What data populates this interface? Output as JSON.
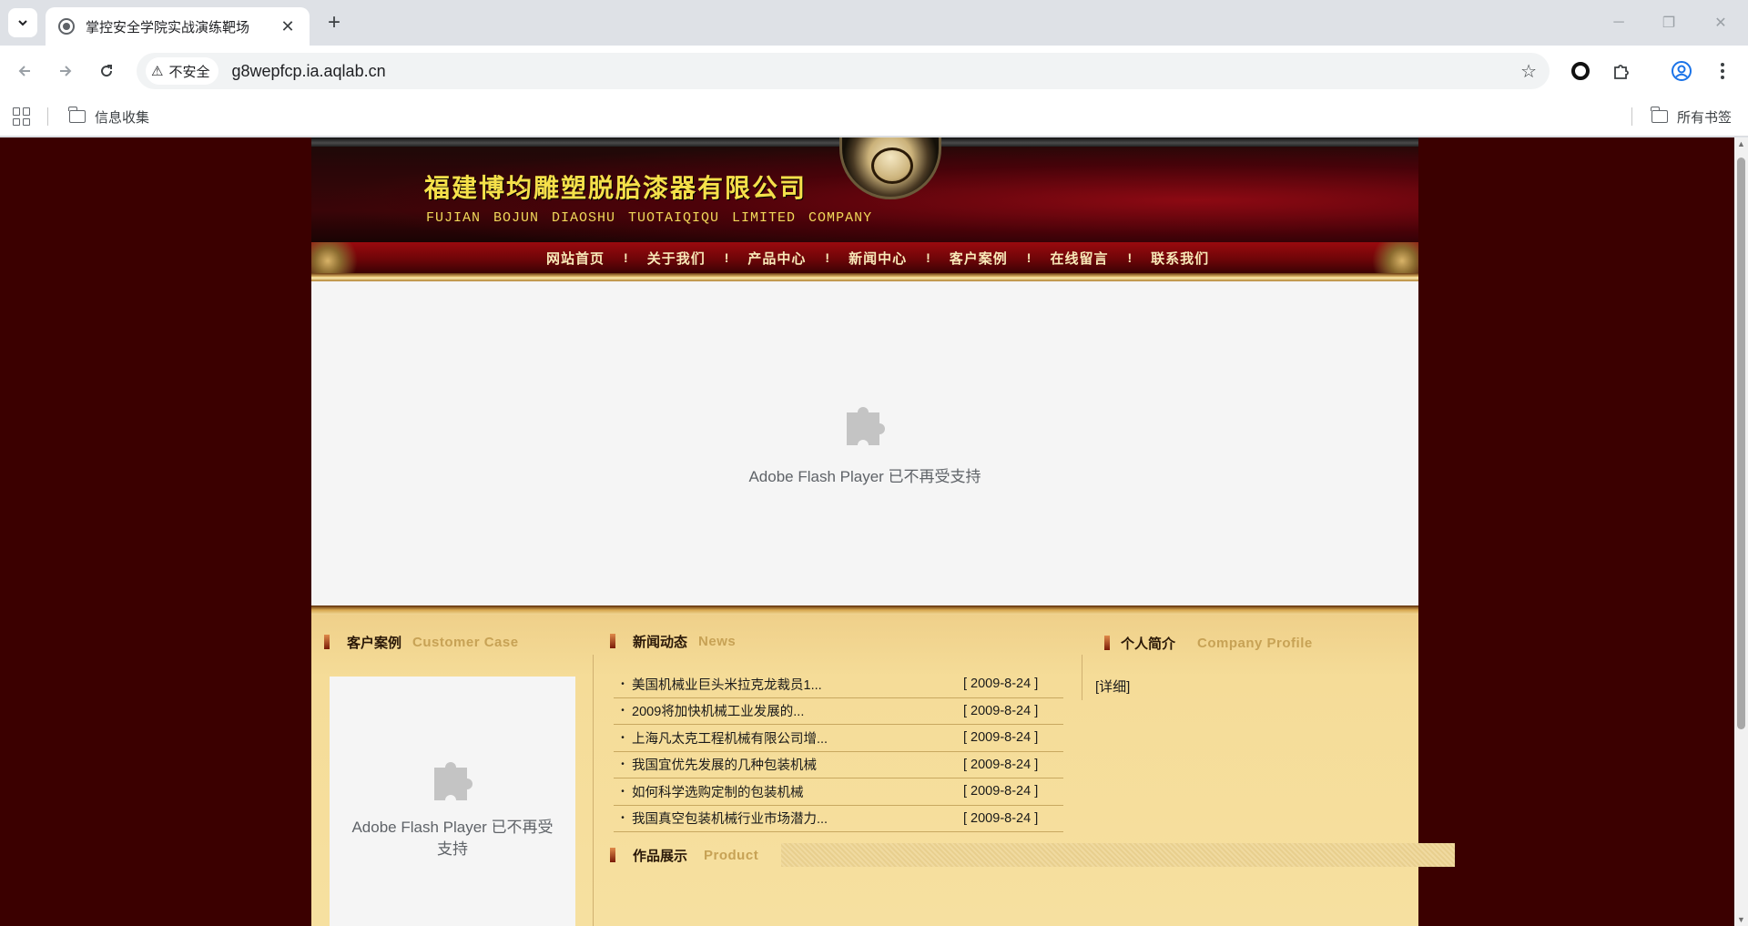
{
  "browser": {
    "tab_title": "掌控安全学院实战演练靶场",
    "security_label": "不安全",
    "url": "g8wepfcp.ia.aqlab.cn",
    "bookmarks": [
      {
        "label": "信息收集"
      }
    ],
    "all_bookmarks_label": "所有书签"
  },
  "site": {
    "company_cn": "福建博均雕塑脱胎漆器有限公司",
    "company_en": "FUJIAN BOJUN DIAOSHU  TUOTAIQIQU  LIMITED COMPANY",
    "nav": [
      "网站首页",
      "关于我们",
      "产品中心",
      "新闻中心",
      "客户案例",
      "在线留言",
      "联系我们"
    ],
    "nav_separator": "!",
    "flash_message": "Adobe Flash Player 已不再受支持",
    "sections": {
      "customer_case": {
        "cn": "客户案例",
        "en": "Customer Case"
      },
      "news": {
        "cn": "新闻动态",
        "en": "News"
      },
      "profile": {
        "cn": "个人简介",
        "en": "Company Profile"
      },
      "product": {
        "cn": "作品展示",
        "en": "Product"
      }
    },
    "news_items": [
      {
        "title": "美国机械业巨头米拉克龙裁员1...",
        "date": "[ 2009-8-24 ]"
      },
      {
        "title": "2009将加快机械工业发展的...",
        "date": "[ 2009-8-24 ]"
      },
      {
        "title": "上海凡太克工程机械有限公司增...",
        "date": "[ 2009-8-24 ]"
      },
      {
        "title": "我国宜优先发展的几种包装机械",
        "date": "[ 2009-8-24 ]"
      },
      {
        "title": "如何科学选购定制的包装机械",
        "date": "[ 2009-8-24 ]"
      },
      {
        "title": "我国真空包装机械行业市场潜力...",
        "date": "[ 2009-8-24 ]"
      }
    ],
    "detail_link": "[详细]"
  },
  "colors": {
    "page_background": "#3b0000",
    "title_yellow": "#f5e04a",
    "section_en": "#c7a255"
  }
}
